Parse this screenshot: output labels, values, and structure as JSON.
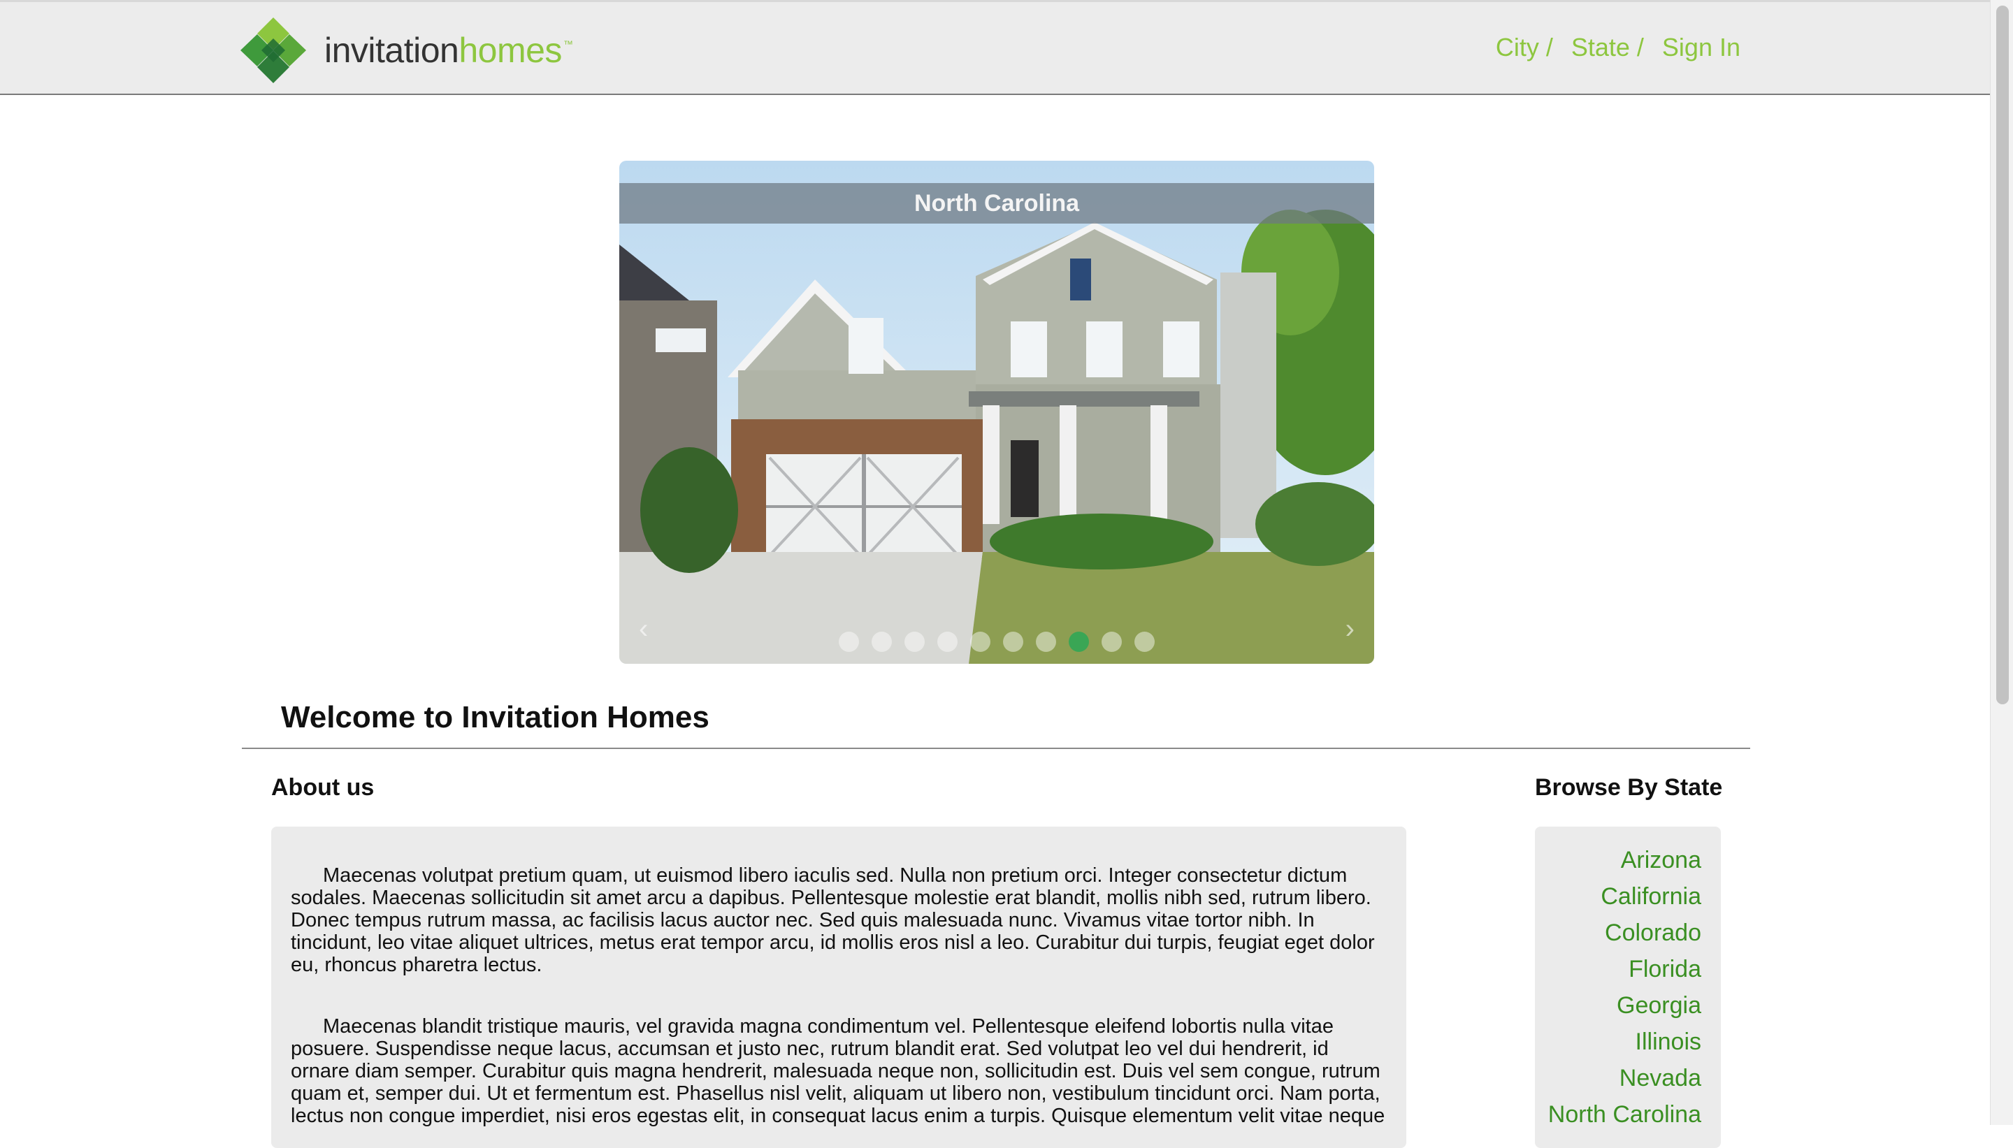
{
  "header": {
    "logo_word_1": "invitation",
    "logo_word_2": "homes",
    "logo_tm": "™",
    "nav": [
      "City /",
      "State /",
      "Sign In"
    ]
  },
  "carousel": {
    "caption": "North Carolina",
    "prev_icon": "‹",
    "next_icon": "›",
    "slide_count": 10,
    "active_index": 7
  },
  "welcome": "Welcome to Invitation Homes",
  "about": {
    "title": "About us",
    "paragraphs": [
      "Maecenas volutpat pretium quam, ut euismod libero iaculis sed. Nulla non pretium orci. Integer consectetur dictum sodales. Maecenas sollicitudin sit amet arcu a dapibus. Pellentesque molestie erat blandit, mollis nibh sed, rutrum libero. Donec tempus rutrum massa, ac facilisis lacus auctor nec. Sed quis malesuada nunc. Vivamus vitae tortor nibh. In tincidunt, leo vitae aliquet ultrices, metus erat tempor arcu, id mollis eros nisl a leo. Curabitur dui turpis, feugiat eget dolor eu, rhoncus pharetra lectus.",
      "Maecenas blandit tristique mauris, vel gravida magna condimentum vel. Pellentesque eleifend lobortis nulla vitae posuere. Suspendisse neque lacus, accumsan et justo nec, rutrum blandit erat. Sed volutpat leo vel dui hendrerit, id ornare diam semper. Curabitur quis magna hendrerit, malesuada neque non, sollicitudin est. Duis vel sem congue, rutrum quam et, semper dui. Ut et fermentum est. Phasellus nisl velit, aliquam ut libero non, vestibulum tincidunt orci. Nam porta, lectus non congue imperdiet, nisi eros egestas elit, in consequat lacus enim a turpis. Quisque elementum velit vitae neque"
    ]
  },
  "browse": {
    "title": "Browse By State",
    "states": [
      "Arizona",
      "California",
      "Colorado",
      "Florida",
      "Georgia",
      "Illinois",
      "Nevada",
      "North Carolina"
    ]
  },
  "colors": {
    "brand_green": "#8dc63f",
    "link_green": "#3a8f22",
    "active_dot": "#3aa655"
  }
}
